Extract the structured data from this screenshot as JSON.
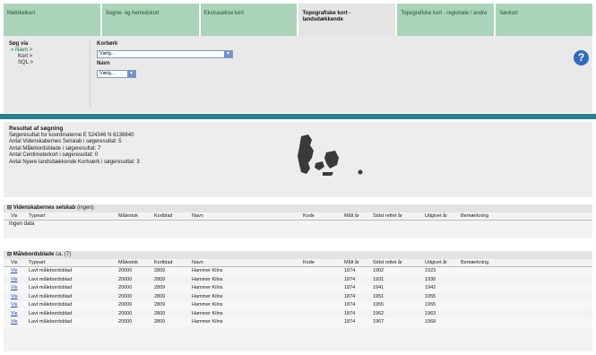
{
  "tabs": [
    {
      "label": "Matrikelkort",
      "active": false
    },
    {
      "label": "Sogne- og herredskort",
      "active": false
    },
    {
      "label": "Ekstrasekse kort",
      "active": false
    },
    {
      "label": "Topografiske kort - landsdækkende",
      "active": true
    },
    {
      "label": "Topografiske kort - regionale / andre",
      "active": false
    },
    {
      "label": "Søvkort",
      "active": false
    }
  ],
  "search": {
    "sog_via_label": "Søg via",
    "options": [
      "Navn >",
      "Kort >",
      "SQL >"
    ],
    "field1_label": "Korbørk",
    "field1_value": "Vælg...",
    "field2_label": "Navn",
    "field2_value": "Vælg..."
  },
  "help_label": "?",
  "result": {
    "title": "Resultat af søgning",
    "lines": [
      "Søgeresultat for koordinaterne E 524346 N 6136840",
      "Antal Videnskabernes Selskab i søgeresultat: 5",
      "Antal Målebordsblade i søgeresultat: 7",
      "Antal Centimeterkort i søgeresultat: 0",
      "Antal Nyere landsdækkende Kortværk i søgeresultat: 3"
    ]
  },
  "sections": {
    "vid": {
      "title": "Videnskabernes selskab",
      "count": "(ingen)",
      "headers": [
        "Vis",
        "Typeart",
        "Målestok",
        "Kortblad",
        "Navn",
        "Kode",
        "Målt år",
        "Sidst rettet år",
        "Udgivet år",
        "Bemærkning"
      ],
      "empty_text": "Ingen data"
    },
    "maal": {
      "title": "Målebordsblade",
      "count": "ca. (7)",
      "headers": [
        "Vis",
        "Typeart",
        "Målestok",
        "Kortblad",
        "Navn",
        "Kode",
        "Målt år",
        "Sidst rettet år",
        "Udgivet år",
        "Bemærkning"
      ],
      "rows": [
        {
          "vis": "Vis",
          "type": "Lavt målebordsblad",
          "maal": "20000",
          "kort": "2809",
          "navn": "Hammer Kilns",
          "maalt": "1874",
          "sidst": "1902",
          "udg": "1923"
        },
        {
          "vis": "Vis",
          "type": "Lavt målebordsblad",
          "maal": "20000",
          "kort": "2809",
          "navn": "Hammer Kilns",
          "maalt": "1874",
          "sidst": "1931",
          "udg": "1930"
        },
        {
          "vis": "Vis",
          "type": "Lavt målebordsblad",
          "maal": "20000",
          "kort": "2809",
          "navn": "Hammer Kilns",
          "maalt": "1874",
          "sidst": "1941",
          "udg": "1942"
        },
        {
          "vis": "Vis",
          "type": "Lavt målebordsblad",
          "maal": "20000",
          "kort": "2809",
          "navn": "Hammer Kilns",
          "maalt": "1874",
          "sidst": "1951",
          "udg": "1955"
        },
        {
          "vis": "Vis",
          "type": "Lavt målebordsblad",
          "maal": "20000",
          "kort": "2809",
          "navn": "Hammer Kilns",
          "maalt": "1874",
          "sidst": "1955",
          "udg": "1955"
        },
        {
          "vis": "Vis",
          "type": "Lavt målebordsblad",
          "maal": "20000",
          "kort": "2809",
          "navn": "Hammer Kilns",
          "maalt": "1874",
          "sidst": "1962",
          "udg": "1963"
        },
        {
          "vis": "Vis",
          "type": "Lavt målebordsblad",
          "maal": "20000",
          "kort": "2809",
          "navn": "Hammer Kilns",
          "maalt": "1874",
          "sidst": "1967",
          "udg": "1968"
        }
      ]
    }
  },
  "colors": {
    "tab": "#a9d4b8",
    "accent_bar": "#2b7f8f",
    "link": "#2244aa"
  }
}
